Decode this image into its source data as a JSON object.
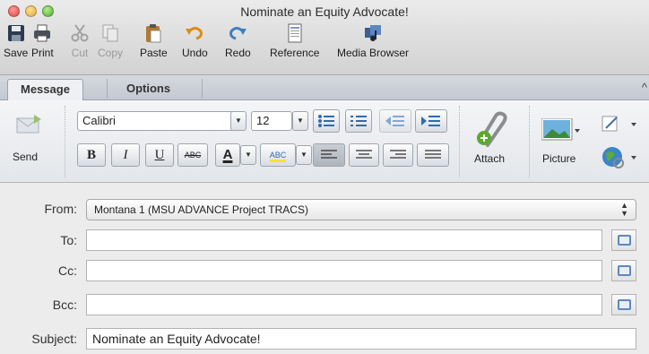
{
  "window": {
    "title": "Nominate an Equity Advocate!"
  },
  "toolbar": {
    "save": "Save",
    "print": "Print",
    "cut": "Cut",
    "copy": "Copy",
    "paste": "Paste",
    "undo": "Undo",
    "redo": "Redo",
    "reference": "Reference",
    "media_browser": "Media Browser"
  },
  "tabs": {
    "message": "Message",
    "options": "Options"
  },
  "ribbon": {
    "send": "Send",
    "font_name": "Calibri",
    "font_size": "12",
    "bold": "B",
    "italic": "I",
    "underline": "U",
    "strike": "ABC",
    "font_color": "A",
    "highlight": "ABC",
    "attach": "Attach",
    "picture": "Picture"
  },
  "header": {
    "from_label": "From:",
    "from_value": "Montana 1 (MSU ADVANCE Project TRACS)",
    "to_label": "To:",
    "to_value": "",
    "cc_label": "Cc:",
    "cc_value": "",
    "bcc_label": "Bcc:",
    "bcc_value": "",
    "subject_label": "Subject:",
    "subject_value": "Nominate an Equity Advocate!"
  }
}
